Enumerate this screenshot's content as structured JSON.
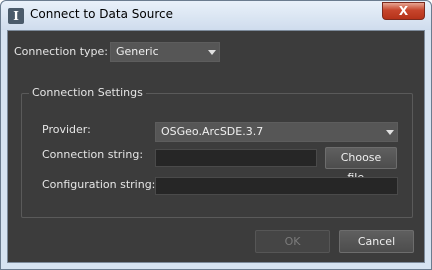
{
  "window": {
    "title": "Connect to Data Source",
    "close_label": "X"
  },
  "connection_type": {
    "label": "Connection type:",
    "value": "Generic"
  },
  "settings": {
    "group_title": "Connection Settings",
    "provider_label": "Provider:",
    "provider_value": "OSGeo.ArcSDE.3.7",
    "connection_string_label": "Connection string:",
    "connection_string_value": "",
    "choose_file_label": "Choose file...",
    "configuration_string_label": "Configuration string:",
    "configuration_string_value": ""
  },
  "footer": {
    "ok_label": "OK",
    "cancel_label": "Cancel"
  }
}
